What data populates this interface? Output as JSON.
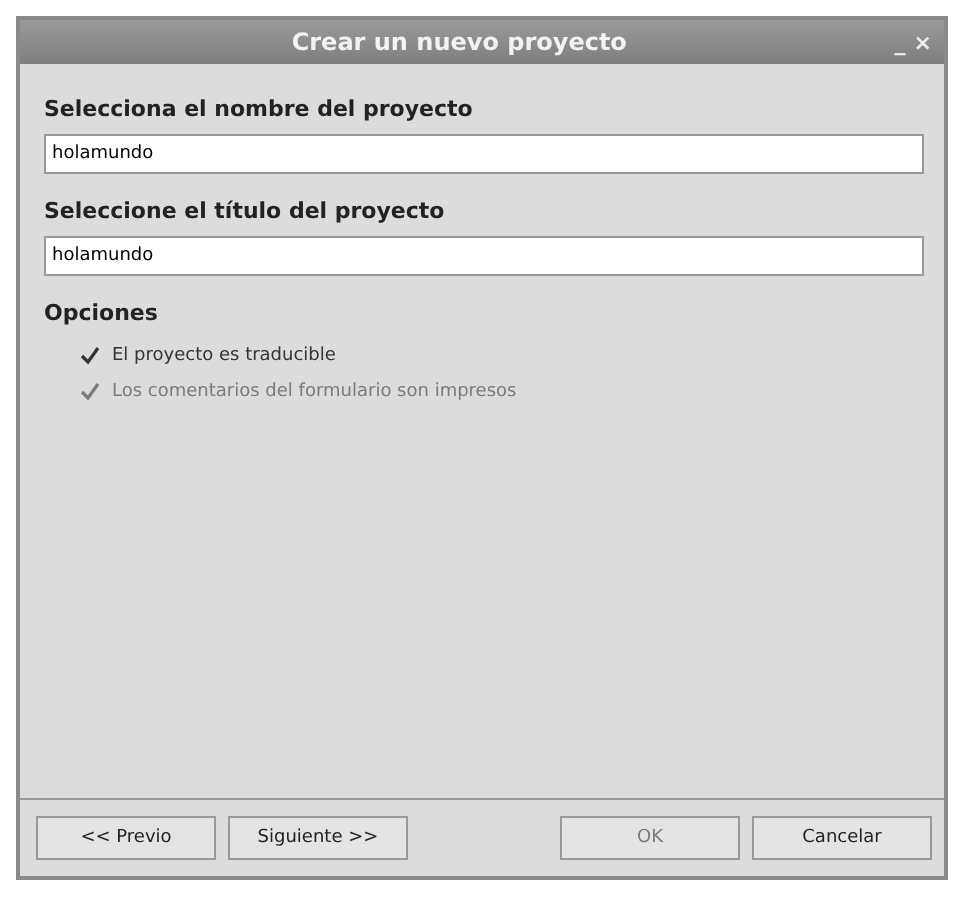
{
  "window": {
    "title": "Crear un nuevo proyecto",
    "controls": [
      "_",
      "×"
    ]
  },
  "fields": [
    {
      "label": "Selecciona el nombre del proyecto",
      "value": "holamundo"
    },
    {
      "label": "Seleccione el título del proyecto",
      "value": "holamundo"
    }
  ],
  "options": {
    "heading": "Opciones",
    "items": [
      {
        "label": "El proyecto es traducible",
        "checked": true,
        "disabled": false
      },
      {
        "label": "Los comentarios del formulario son impresos",
        "checked": true,
        "disabled": true
      }
    ]
  },
  "buttons": [
    {
      "label": "<< Previo",
      "disabled": false
    },
    {
      "label": "Siguiente >>",
      "disabled": false
    },
    {
      "label": "OK",
      "disabled": true
    },
    {
      "label": "Cancelar",
      "disabled": false
    }
  ]
}
